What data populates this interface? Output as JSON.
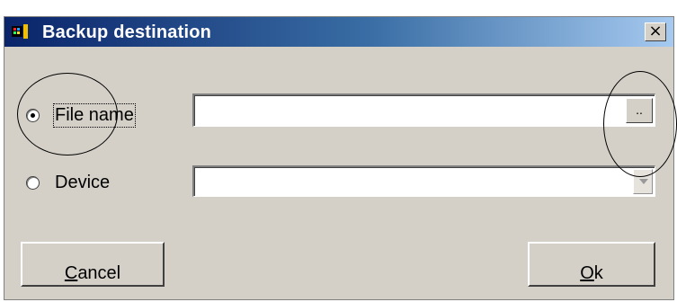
{
  "dialog": {
    "title": "Backup destination",
    "close_glyph": "×"
  },
  "options": {
    "file_name": {
      "label": "File name",
      "selected": true,
      "value": "",
      "browse_label": ".."
    },
    "device": {
      "label": "Device",
      "selected": false,
      "value": ""
    }
  },
  "buttons": {
    "cancel_first": "C",
    "cancel_rest": "ancel",
    "ok_first": "O",
    "ok_rest": "k"
  },
  "icons": {
    "app": "app-icon",
    "close": "close-icon",
    "dropdown": "chevron-down-icon"
  },
  "colors": {
    "titlebar_start": "#0a246a",
    "titlebar_end": "#a6caf0",
    "dialog_bg": "#d4d0c8"
  }
}
